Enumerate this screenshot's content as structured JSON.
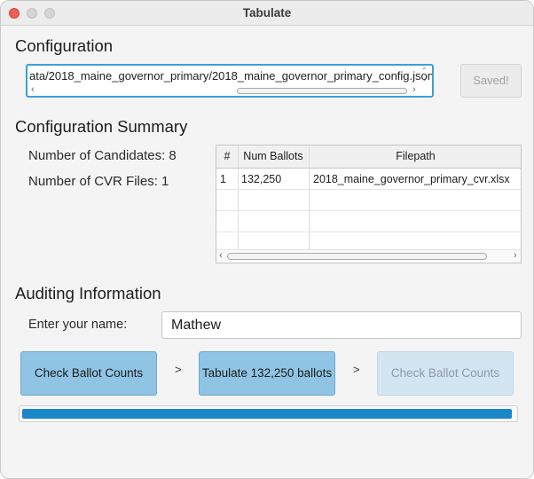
{
  "window": {
    "title": "Tabulate"
  },
  "configuration": {
    "heading": "Configuration",
    "path_value": "ata/2018_maine_governor_primary/2018_maine_governor_primary_config.json",
    "saved_label": "Saved!"
  },
  "summary": {
    "heading": "Configuration Summary",
    "candidates_label": "Number of Candidates: 8",
    "cvr_files_label": "Number of CVR Files: 1",
    "table": {
      "columns": [
        "#",
        "Num Ballots",
        "Filepath"
      ],
      "rows": [
        [
          "1",
          "132,250",
          "2018_maine_governor_primary_cvr.xlsx"
        ]
      ]
    }
  },
  "auditing": {
    "heading": "Auditing Information",
    "name_label": "Enter your name:",
    "name_value": "Mathew",
    "step1_label": "Check Ballot Counts",
    "step2_label": "Tabulate 132,250 ballots",
    "step3_label": "Check Ballot Counts",
    "separator": ">",
    "progress_fraction": 0.995
  },
  "colors": {
    "accent": "#1b86c8",
    "button_enabled": "#8fc4e4",
    "button_disabled": "#d3e5f1",
    "focus_ring": "#3aa0d8"
  }
}
